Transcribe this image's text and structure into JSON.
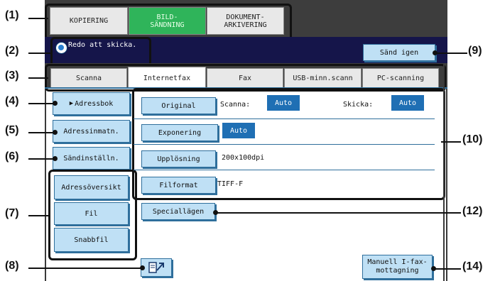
{
  "callouts": {
    "c1": "(1)",
    "c2": "(2)",
    "c3": "(3)",
    "c4": "(4)",
    "c5": "(5)",
    "c6": "(6)",
    "c7": "(7)",
    "c8": "(8)",
    "c9": "(9)",
    "c10": "(10)",
    "c12": "(12)",
    "c14": "(14)"
  },
  "modes": {
    "copy": "KOPIERING",
    "send": "BILD-\nSÄNDNING",
    "archive": "DOKUMENT-\nARKIVERING"
  },
  "status": {
    "message": "Redo att skicka.",
    "resend": "Sänd igen"
  },
  "tabs": [
    "Scanna",
    "Internetfax",
    "Fax",
    "USB-minn.scann",
    "PC-scanning"
  ],
  "left_buttons": {
    "address_book": "Adressbok",
    "address_entry": "Adressinmatn.",
    "send_settings": "Sändinställn.",
    "address_overview": "Adressöversikt",
    "file": "Fil",
    "quick_file": "Snabbfil"
  },
  "settings": {
    "original_label": "Original",
    "scan_label": "Scanna:",
    "scan_value": "Auto",
    "send_label": "Skicka:",
    "send_value": "Auto",
    "exposure_label": "Exponering",
    "exposure_value": "Auto",
    "resolution_label": "Upplösning",
    "resolution_value": "200x100dpi",
    "format_label": "Filformat",
    "format_value": "TIFF-F"
  },
  "special_modes": "Speciallägen",
  "manual_receive": "Manuell I-fax-\nmottagning",
  "colors": {
    "active_mode": "#2fb45a",
    "button": "#bfe0f5",
    "auto_box": "#1f6fb4",
    "status_bar": "#15154a"
  }
}
